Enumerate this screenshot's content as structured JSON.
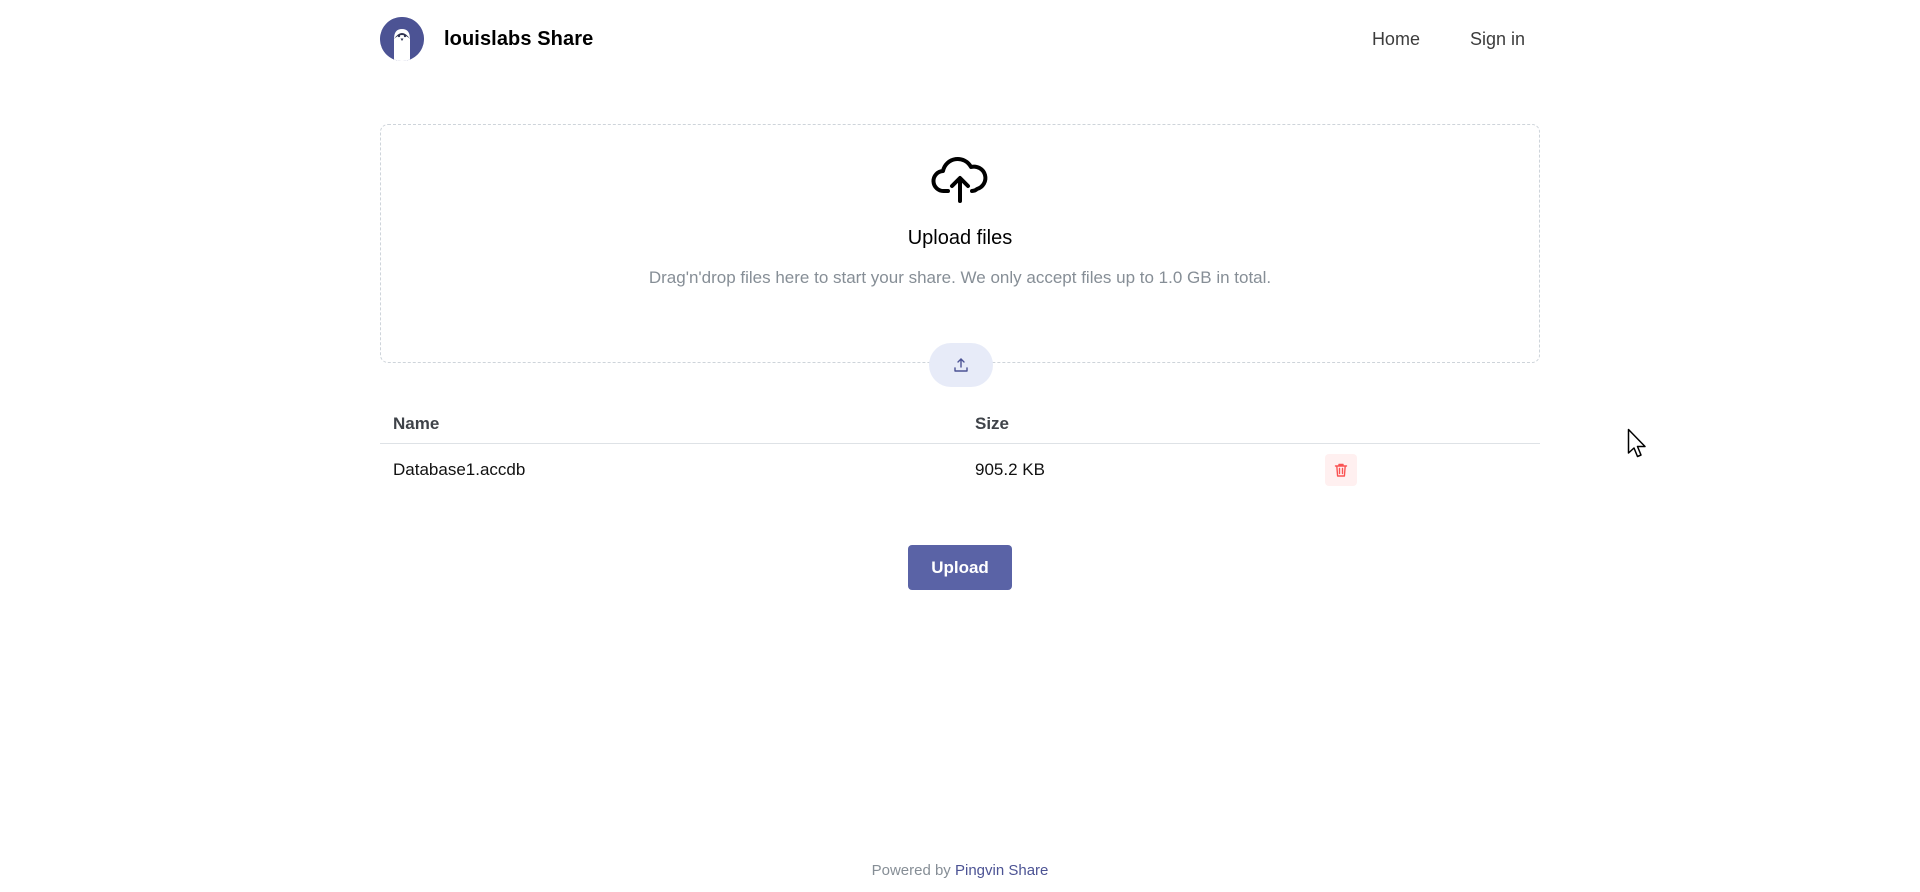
{
  "header": {
    "logo_icon": "penguin-logo-icon",
    "brand_name": "louislabs Share",
    "nav": [
      {
        "label": "Home"
      },
      {
        "label": "Sign in"
      }
    ]
  },
  "dropzone": {
    "icon": "cloud-upload-icon",
    "title": "Upload files",
    "description": "Drag'n'drop files here to start your share. We only accept files up to 1.0 GB in total.",
    "button_icon": "upload-icon"
  },
  "table": {
    "columns": [
      "Name",
      "Size"
    ],
    "rows": [
      {
        "name": "Database1.accdb",
        "size": "905.2 KB",
        "action_icon": "trash-icon"
      }
    ]
  },
  "actions": {
    "upload_label": "Upload"
  },
  "footer": {
    "prefix": "Powered by",
    "link": "Pingvin Share"
  },
  "colors": {
    "primary": "#5a63a6",
    "logo_bg": "#4c5394",
    "danger": "#fa5252",
    "muted_text": "#868e96"
  }
}
